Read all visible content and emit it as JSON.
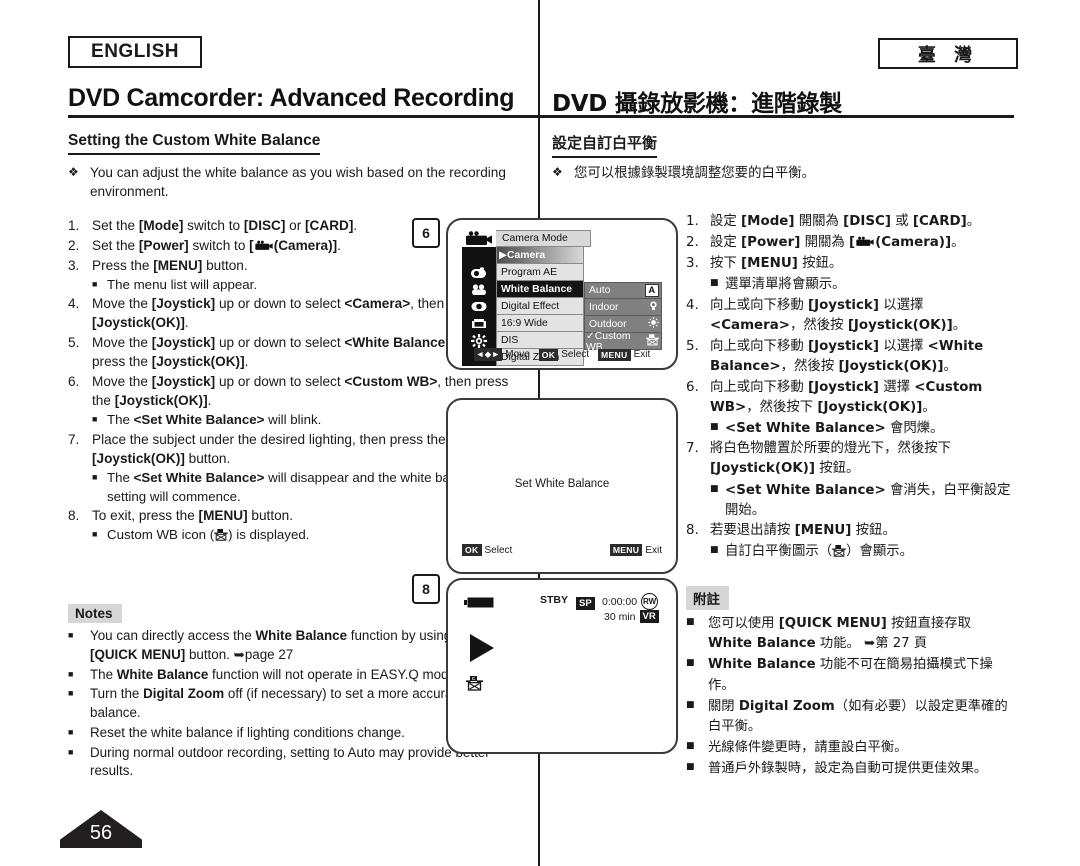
{
  "header": {
    "lang_en": "ENGLISH",
    "lang_zh": "臺 灣",
    "title_en": "DVD Camcorder: Advanced Recording",
    "title_zh": "DVD 攝錄放影機：進階錄製",
    "section_en": "Setting the Custom White Balance",
    "section_zh": "設定自訂白平衡"
  },
  "english": {
    "intro_marker": "❖",
    "intro": "You can adjust the white balance as you wish based on the recording environment.",
    "steps": [
      {
        "num": "1.",
        "html": "Set the <b>[Mode]</b> switch to <b>[DISC]</b> or <b>[CARD]</b>."
      },
      {
        "num": "2.",
        "html": "Set the <b>[Power]</b> switch to <b>[</b>&nbsp;<b>(Camera)]</b>."
      },
      {
        "num": "3.",
        "html": "Press the <b>[MENU]</b> button."
      },
      {
        "num": "",
        "sub": "The menu list will appear."
      },
      {
        "num": "4.",
        "html": "Move the <b>[Joystick]</b> up or down to select <b>&lt;Camera&gt;</b>, then press the <b>[Joystick(OK)]</b>."
      },
      {
        "num": "5.",
        "html": "Move the <b>[Joystick]</b> up or down to select <b>&lt;White Balance&gt;</b>, then press the <b>[Joystick(OK)]</b>."
      },
      {
        "num": "6.",
        "html": "Move the <b>[Joystick]</b> up or down to select <b>&lt;Custom WB&gt;</b>, then press the <b>[Joystick(OK)]</b>."
      },
      {
        "num": "",
        "sub": "The <b>&lt;Set White Balance&gt;</b> will blink."
      },
      {
        "num": "7.",
        "html": "Place the subject under the desired lighting, then press the <b>[Joystick(OK)]</b> button."
      },
      {
        "num": "",
        "sub": "The <b>&lt;Set White Balance&gt;</b> will disappear and the white balance setting will commence."
      },
      {
        "num": "8.",
        "html": "To exit, press the <b>[MENU]</b> button."
      },
      {
        "num": "",
        "sub": "Custom WB icon (&nbsp;) is displayed."
      }
    ],
    "notes_title": "Notes",
    "notes": [
      "You can directly access the <b>White Balance</b> function by using the <b>[QUICK MENU]</b> button. ➥page 27",
      "The <b>White Balance</b> function will not operate in EASY.Q mode.",
      "Turn the <b>Digital Zoom</b> off (if necessary) to set a more accurate white balance.",
      "Reset the white balance if lighting conditions change.",
      "During normal outdoor recording, setting to Auto may provide better results."
    ]
  },
  "chinese": {
    "intro_marker": "❖",
    "intro": "您可以根據錄製環境調整您要的白平衡。",
    "steps": [
      {
        "num": "1.",
        "html": "設定 <b>[Mode]</b> 開關為 <b>[DISC]</b> 或 <b>[CARD]</b>。"
      },
      {
        "num": "2.",
        "html": "設定 <b>[Power]</b> 開關為 <b>[</b>&nbsp;<b>(Camera)]</b>。"
      },
      {
        "num": "3.",
        "html": "按下 <b>[MENU]</b> 按鈕。"
      },
      {
        "num": "",
        "sub": "選單清單將會顯示。"
      },
      {
        "num": "4.",
        "html": "向上或向下移動 <b>[Joystick]</b> 以選擇 <b>&lt;Camera&gt;</b>，然後按 <b>[Joystick(OK)]</b>。"
      },
      {
        "num": "5.",
        "html": "向上或向下移動 <b>[Joystick]</b> 以選擇 <b>&lt;White Balance&gt;</b>，然後按 <b>[Joystick(OK)]</b>。"
      },
      {
        "num": "6.",
        "html": "向上或向下移動 <b>[Joystick]</b> 選擇 <b>&lt;Custom WB&gt;</b>，然後按下 <b>[Joystick(OK)]</b>。"
      },
      {
        "num": "",
        "sub": "<b>&lt;Set White Balance&gt;</b> 會閃爍。"
      },
      {
        "num": "7.",
        "html": "將白色物體置於所要的燈光下，然後按下 <b>[Joystick(OK)]</b> 按鈕。"
      },
      {
        "num": "",
        "sub": "<b>&lt;Set White Balance&gt;</b> 會消失，白平衡設定開始。"
      },
      {
        "num": "8.",
        "html": "若要退出請按 <b>[MENU]</b> 按鈕。"
      },
      {
        "num": "",
        "sub": "自訂白平衡圖示（&nbsp;）會顯示。"
      }
    ],
    "notes_title": "附註",
    "notes": [
      "您可以使用 <b>[QUICK MENU]</b> 按鈕直接存取 <b>White Balance</b> 功能。 ➥第 27 頁",
      "<b>White Balance</b> 功能不可在簡易拍攝模式下操作。",
      "關閉 <b>Digital Zoom</b>（如有必要）以設定更準確的白平衡。",
      "光線條件變更時，請重設白平衡。",
      "普通戶外錄製時，設定為自動可提供更佳效果。"
    ]
  },
  "figures": {
    "step_marker_6": "6",
    "step_marker_8": "8",
    "lcd1": {
      "header_label": "Camera Mode",
      "items": [
        {
          "label": "▶Camera",
          "state": "selected-gradient"
        },
        {
          "label": "Program AE",
          "state": "normal",
          "icon": "program-ae-icon"
        },
        {
          "label": "White Balance",
          "state": "selected-dark",
          "icon": "white-balance-icon"
        },
        {
          "label": "Digital Effect",
          "state": "normal",
          "icon": "digital-effect-icon"
        },
        {
          "label": "16:9 Wide",
          "state": "normal",
          "icon": "wide-icon"
        },
        {
          "label": "DIS",
          "state": "normal",
          "icon": "dis-icon"
        },
        {
          "label": "Digital Zoom",
          "state": "normal",
          "icon": ""
        }
      ],
      "submenu": [
        {
          "label": "Auto",
          "badge": "A",
          "checked": false
        },
        {
          "label": "Indoor",
          "badge": "",
          "checked": false,
          "glyph": "indoor-bulb-icon"
        },
        {
          "label": "Outdoor",
          "badge": "",
          "checked": false,
          "glyph": "outdoor-sun-icon"
        },
        {
          "label": "Custom WB",
          "badge": "",
          "checked": true,
          "glyph": "custom-wb-icon"
        }
      ],
      "bar": [
        {
          "key": "◄◆►",
          "label": "Move"
        },
        {
          "key": "OK",
          "label": "Select"
        },
        {
          "key": "MENU",
          "label": "Exit"
        }
      ]
    },
    "lcd2": {
      "center_text": "Set White Balance",
      "bar_left_key": "OK",
      "bar_left_label": "Select",
      "bar_right_key": "MENU",
      "bar_right_label": "Exit"
    },
    "lcd3": {
      "stby": "STBY",
      "quality": "SP",
      "timecode": "0:00:00",
      "disc_mode": "RW",
      "remaining": "30 min",
      "format": "VR"
    }
  },
  "page_number": "56"
}
